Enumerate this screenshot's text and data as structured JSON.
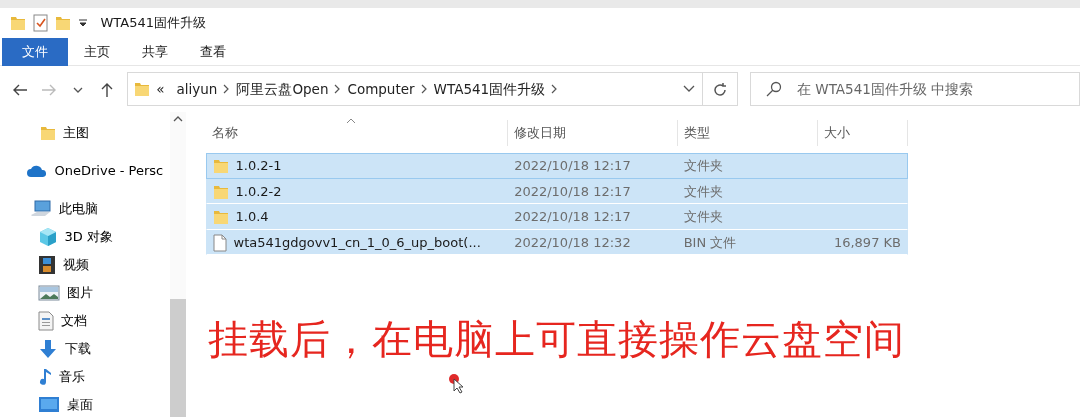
{
  "window": {
    "title": "WTA541固件升级"
  },
  "ribbon_tabs": [
    {
      "label": "文件",
      "selected": true
    },
    {
      "label": "主页",
      "selected": false
    },
    {
      "label": "共享",
      "selected": false
    },
    {
      "label": "查看",
      "selected": false
    }
  ],
  "breadcrumb": [
    "«",
    "aliyun",
    "阿里云盘Open",
    "Computer",
    "WTA541固件升级"
  ],
  "search": {
    "placeholder": "在 WTA541固件升级 中搜索"
  },
  "sidebar": {
    "items": [
      {
        "label": "主图",
        "kind": "folder"
      },
      {
        "label": "OneDrive - Persc",
        "kind": "cloud"
      },
      {
        "label": "此电脑",
        "kind": "pc",
        "children": [
          {
            "label": "3D 对象",
            "kind": "cube"
          },
          {
            "label": "视频",
            "kind": "film"
          },
          {
            "label": "图片",
            "kind": "image"
          },
          {
            "label": "文档",
            "kind": "doc"
          },
          {
            "label": "下载",
            "kind": "download"
          },
          {
            "label": "音乐",
            "kind": "music"
          },
          {
            "label": "桌面",
            "kind": "desktop"
          }
        ]
      }
    ]
  },
  "table": {
    "columns": [
      "名称",
      "修改日期",
      "类型",
      "大小"
    ],
    "rows": [
      {
        "kind": "folder",
        "selected": true,
        "cells": [
          "1.0.2-1",
          "2022/10/18 12:17",
          "文件夹",
          ""
        ]
      },
      {
        "kind": "folder",
        "selected": true,
        "cells": [
          "1.0.2-2",
          "2022/10/18 12:17",
          "文件夹",
          ""
        ]
      },
      {
        "kind": "folder",
        "selected": true,
        "cells": [
          "1.0.4",
          "2022/10/18 12:17",
          "文件夹",
          ""
        ]
      },
      {
        "kind": "file",
        "selected": true,
        "cells": [
          "wta541gdgovv1_cn_1_0_6_up_boot(...",
          "2022/10/18 12:32",
          "BIN 文件",
          "16,897 KB"
        ]
      }
    ]
  },
  "caption": "挂载后，在电脑上可直接操作云盘空间"
}
